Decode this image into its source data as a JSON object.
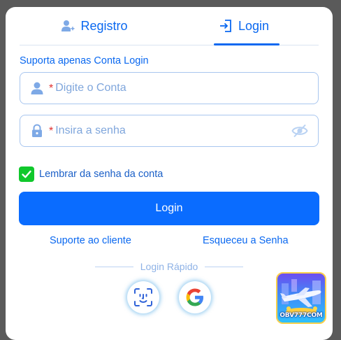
{
  "tabs": {
    "register_label": "Registro",
    "login_label": "Login",
    "active": "login"
  },
  "form": {
    "hint": "Suporta apenas Conta Login",
    "account_required_mark": "*",
    "account_placeholder": "Digite o Conta",
    "account_value": "",
    "password_required_mark": "*",
    "password_placeholder": "Insira a senha",
    "password_value": "",
    "remember_label": "Lembrar da senha da conta",
    "remember_checked": true,
    "submit_label": "Login"
  },
  "links": {
    "support": "Suporte ao cliente",
    "forgot": "Esqueceu a Senha"
  },
  "quick_login": {
    "label": "Login Rápido",
    "options": [
      "face-id-icon",
      "google-icon"
    ]
  },
  "promo": {
    "text": "OBV777COM"
  },
  "colors": {
    "accent": "#0a68f0",
    "button": "#0a6cff",
    "checkbox": "#10c82c",
    "required": "#e03030"
  }
}
